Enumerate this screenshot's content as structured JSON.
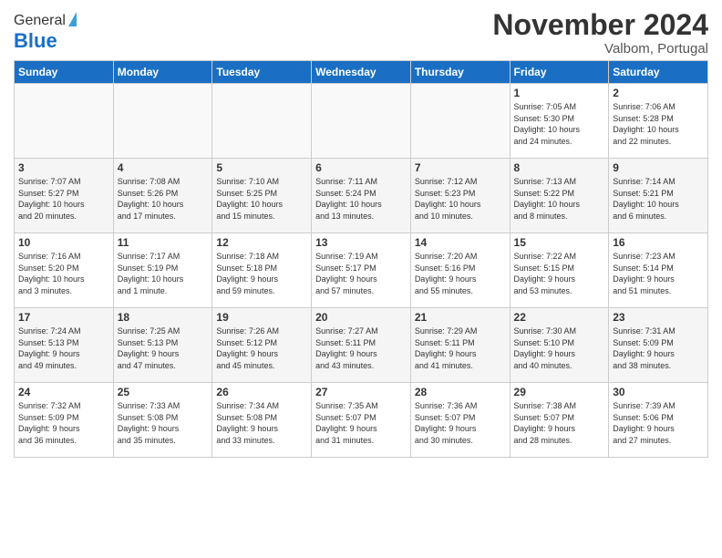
{
  "header": {
    "logo_general": "General",
    "logo_blue": "Blue",
    "month_title": "November 2024",
    "location": "Valbom, Portugal"
  },
  "calendar": {
    "weekdays": [
      "Sunday",
      "Monday",
      "Tuesday",
      "Wednesday",
      "Thursday",
      "Friday",
      "Saturday"
    ],
    "weeks": [
      [
        {
          "day": "",
          "info": ""
        },
        {
          "day": "",
          "info": ""
        },
        {
          "day": "",
          "info": ""
        },
        {
          "day": "",
          "info": ""
        },
        {
          "day": "",
          "info": ""
        },
        {
          "day": "1",
          "info": "Sunrise: 7:05 AM\nSunset: 5:30 PM\nDaylight: 10 hours\nand 24 minutes."
        },
        {
          "day": "2",
          "info": "Sunrise: 7:06 AM\nSunset: 5:28 PM\nDaylight: 10 hours\nand 22 minutes."
        }
      ],
      [
        {
          "day": "3",
          "info": "Sunrise: 7:07 AM\nSunset: 5:27 PM\nDaylight: 10 hours\nand 20 minutes."
        },
        {
          "day": "4",
          "info": "Sunrise: 7:08 AM\nSunset: 5:26 PM\nDaylight: 10 hours\nand 17 minutes."
        },
        {
          "day": "5",
          "info": "Sunrise: 7:10 AM\nSunset: 5:25 PM\nDaylight: 10 hours\nand 15 minutes."
        },
        {
          "day": "6",
          "info": "Sunrise: 7:11 AM\nSunset: 5:24 PM\nDaylight: 10 hours\nand 13 minutes."
        },
        {
          "day": "7",
          "info": "Sunrise: 7:12 AM\nSunset: 5:23 PM\nDaylight: 10 hours\nand 10 minutes."
        },
        {
          "day": "8",
          "info": "Sunrise: 7:13 AM\nSunset: 5:22 PM\nDaylight: 10 hours\nand 8 minutes."
        },
        {
          "day": "9",
          "info": "Sunrise: 7:14 AM\nSunset: 5:21 PM\nDaylight: 10 hours\nand 6 minutes."
        }
      ],
      [
        {
          "day": "10",
          "info": "Sunrise: 7:16 AM\nSunset: 5:20 PM\nDaylight: 10 hours\nand 3 minutes."
        },
        {
          "day": "11",
          "info": "Sunrise: 7:17 AM\nSunset: 5:19 PM\nDaylight: 10 hours\nand 1 minute."
        },
        {
          "day": "12",
          "info": "Sunrise: 7:18 AM\nSunset: 5:18 PM\nDaylight: 9 hours\nand 59 minutes."
        },
        {
          "day": "13",
          "info": "Sunrise: 7:19 AM\nSunset: 5:17 PM\nDaylight: 9 hours\nand 57 minutes."
        },
        {
          "day": "14",
          "info": "Sunrise: 7:20 AM\nSunset: 5:16 PM\nDaylight: 9 hours\nand 55 minutes."
        },
        {
          "day": "15",
          "info": "Sunrise: 7:22 AM\nSunset: 5:15 PM\nDaylight: 9 hours\nand 53 minutes."
        },
        {
          "day": "16",
          "info": "Sunrise: 7:23 AM\nSunset: 5:14 PM\nDaylight: 9 hours\nand 51 minutes."
        }
      ],
      [
        {
          "day": "17",
          "info": "Sunrise: 7:24 AM\nSunset: 5:13 PM\nDaylight: 9 hours\nand 49 minutes."
        },
        {
          "day": "18",
          "info": "Sunrise: 7:25 AM\nSunset: 5:13 PM\nDaylight: 9 hours\nand 47 minutes."
        },
        {
          "day": "19",
          "info": "Sunrise: 7:26 AM\nSunset: 5:12 PM\nDaylight: 9 hours\nand 45 minutes."
        },
        {
          "day": "20",
          "info": "Sunrise: 7:27 AM\nSunset: 5:11 PM\nDaylight: 9 hours\nand 43 minutes."
        },
        {
          "day": "21",
          "info": "Sunrise: 7:29 AM\nSunset: 5:11 PM\nDaylight: 9 hours\nand 41 minutes."
        },
        {
          "day": "22",
          "info": "Sunrise: 7:30 AM\nSunset: 5:10 PM\nDaylight: 9 hours\nand 40 minutes."
        },
        {
          "day": "23",
          "info": "Sunrise: 7:31 AM\nSunset: 5:09 PM\nDaylight: 9 hours\nand 38 minutes."
        }
      ],
      [
        {
          "day": "24",
          "info": "Sunrise: 7:32 AM\nSunset: 5:09 PM\nDaylight: 9 hours\nand 36 minutes."
        },
        {
          "day": "25",
          "info": "Sunrise: 7:33 AM\nSunset: 5:08 PM\nDaylight: 9 hours\nand 35 minutes."
        },
        {
          "day": "26",
          "info": "Sunrise: 7:34 AM\nSunset: 5:08 PM\nDaylight: 9 hours\nand 33 minutes."
        },
        {
          "day": "27",
          "info": "Sunrise: 7:35 AM\nSunset: 5:07 PM\nDaylight: 9 hours\nand 31 minutes."
        },
        {
          "day": "28",
          "info": "Sunrise: 7:36 AM\nSunset: 5:07 PM\nDaylight: 9 hours\nand 30 minutes."
        },
        {
          "day": "29",
          "info": "Sunrise: 7:38 AM\nSunset: 5:07 PM\nDaylight: 9 hours\nand 28 minutes."
        },
        {
          "day": "30",
          "info": "Sunrise: 7:39 AM\nSunset: 5:06 PM\nDaylight: 9 hours\nand 27 minutes."
        }
      ]
    ]
  }
}
